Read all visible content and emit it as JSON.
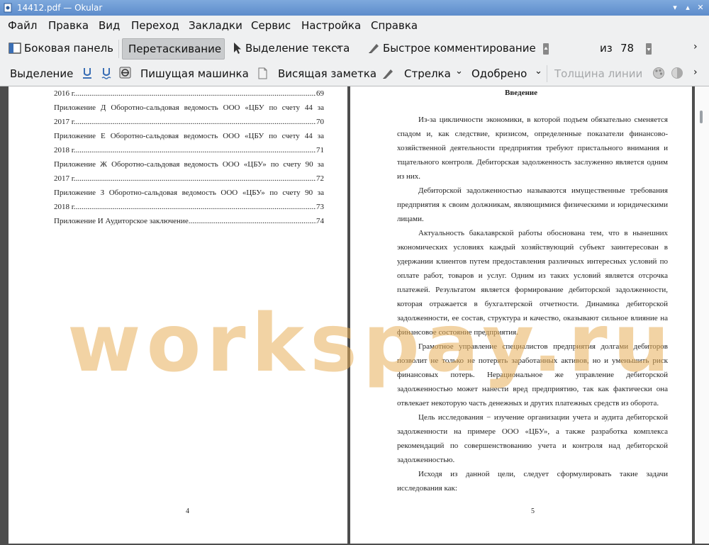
{
  "window": {
    "title": "14412.pdf — Okular"
  },
  "menu": [
    "Файл",
    "Правка",
    "Вид",
    "Переход",
    "Закладки",
    "Сервис",
    "Настройка",
    "Справка"
  ],
  "toolbar1": {
    "sidebar": "Боковая панель",
    "browse": "Перетаскивание",
    "text_select": "Выделение текста",
    "quick_annotate": "Быстрое комментирование",
    "page_current": "4",
    "page_of": "из",
    "page_total": "78"
  },
  "toolbar2": {
    "highlight": "Выделение",
    "typewriter": "Пишущая машинка",
    "note": "Висящая заметка",
    "arrow": "Стрелка",
    "stamp": "Одобрено",
    "line_width": "Толщина линии"
  },
  "page4": {
    "toc": [
      {
        "text": "2016 г.",
        "page": "69"
      },
      {
        "text": "Приложение Д Оборотно-сальдовая ведомость ООО «ЦБУ по счету 44 за",
        "cont": "2017 г.",
        "page": "70"
      },
      {
        "text": "Приложение Е Оборотно-сальдовая ведомость ООО «ЦБУ по счету 44 за",
        "cont": "2018 г.",
        "page": "71"
      },
      {
        "text": "Приложение Ж Оборотно-сальдовая ведомость ООО «ЦБУ» по счету 90 за",
        "cont": "2017 г.",
        "page": "72"
      },
      {
        "text": "Приложение З Оборотно-сальдовая ведомость ООО «ЦБУ» по счету 90 за",
        "cont": "2018 г.",
        "page": "73"
      },
      {
        "text": "Приложение И Аудиторское заключение",
        "page": "74"
      }
    ],
    "number": "4"
  },
  "page5": {
    "heading": "Введение",
    "paragraphs": [
      "Из-за цикличности экономики, в которой подъем обязательно сменяется спадом и, как следствие, кризисом, определенные показатели финансово-хозяйственной деятельности предприятия требуют пристального внимания и тщательного контроля. Дебиторская задолженность заслуженно является одним из них.",
      "Дебиторской задолженностью называются имущественные требования предприятия к своим должникам, являющимися физическими и юридическими лицами.",
      "Актуальность бакалаврской работы обоснована тем, что в нынешних экономических условиях каждый хозяйствующий субъект заинтересован в удержании клиентов путем предоставления различных интересных условий по оплате работ, товаров и услуг. Одним из таких условий является отсрочка платежей. Результатом является формирование дебиторской задолженности, которая отражается в бухгалтерской отчетности. Динамика дебиторской задолженности, ее состав, структура и качество, оказывают сильное влияние на финансовое состояние предприятия.",
      "Грамотное управление специалистов предприятия долгами дебиторов позволит не только не потерять заработанных активов, но и уменьшить риск финансовых потерь. Нерациональное же управление дебиторской задолженностью может нанести вред предприятию, так как фактически она отвлекает некоторую часть денежных и других платежных средств из оборота.",
      "Цель исследования − изучение организации учета и аудита дебиторской задолженности на примере ООО «ЦБУ», а также разработка комплекса рекомендаций по совершенствованию учета и контроля над дебиторской задолженностью.",
      "Исходя из данной цели, следует сформулировать такие задачи исследования как:"
    ],
    "number": "5"
  },
  "watermark": "workspay.ru",
  "colors": {
    "titlebar": "#6b97d3",
    "toolbar": "#eff0f1",
    "viewer": "#4d4d4d",
    "watermark": "#e8af5a"
  }
}
